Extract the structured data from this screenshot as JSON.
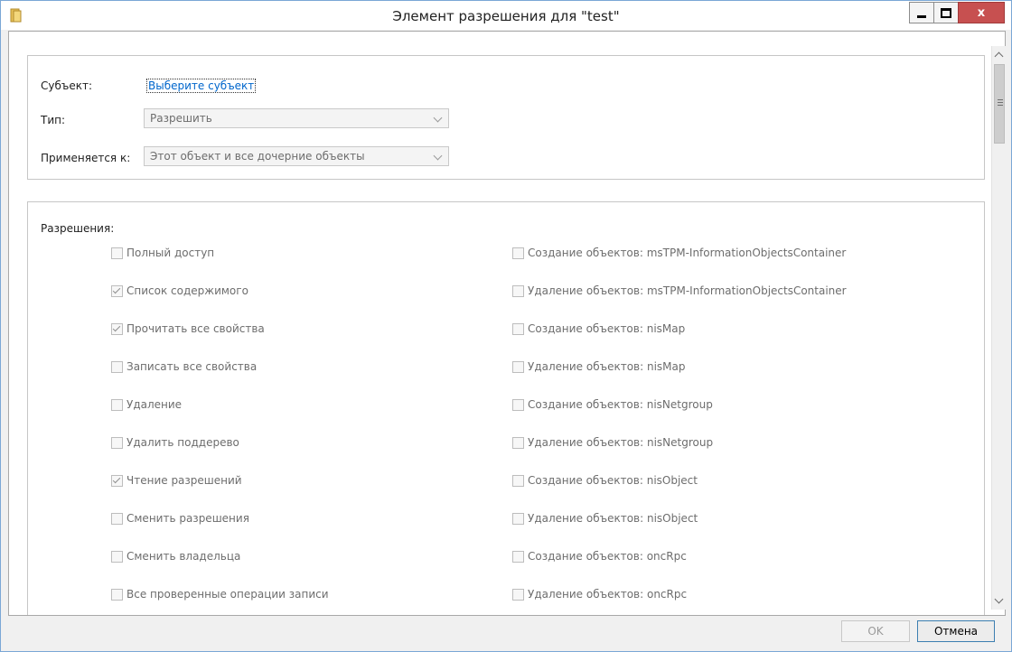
{
  "window": {
    "title": "Элемент разрешения для \"test\"",
    "close_label": "x"
  },
  "subject": {
    "label": "Субъект:",
    "link": "Выберите субъект"
  },
  "type": {
    "label": "Тип:",
    "value": "Разрешить"
  },
  "applies_to": {
    "label": "Применяется к:",
    "value": "Этот объект и все дочерние объекты"
  },
  "permissions": {
    "title": "Разрешения:",
    "left": [
      {
        "label": "Полный доступ",
        "checked": false
      },
      {
        "label": "Список содержимого",
        "checked": true
      },
      {
        "label": "Прочитать все свойства",
        "checked": true
      },
      {
        "label": "Записать все свойства",
        "checked": false
      },
      {
        "label": "Удаление",
        "checked": false
      },
      {
        "label": "Удалить поддерево",
        "checked": false
      },
      {
        "label": "Чтение разрешений",
        "checked": true
      },
      {
        "label": "Сменить разрешения",
        "checked": false
      },
      {
        "label": "Сменить владельца",
        "checked": false
      },
      {
        "label": "Все проверенные операции записи",
        "checked": false
      }
    ],
    "right": [
      {
        "label": "Создание объектов: msTPM-InformationObjectsContainer",
        "checked": false
      },
      {
        "label": "Удаление объектов: msTPM-InformationObjectsContainer",
        "checked": false
      },
      {
        "label": "Создание объектов: nisMap",
        "checked": false
      },
      {
        "label": "Удаление объектов: nisMap",
        "checked": false
      },
      {
        "label": "Создание объектов: nisNetgroup",
        "checked": false
      },
      {
        "label": "Удаление объектов: nisNetgroup",
        "checked": false
      },
      {
        "label": "Создание объектов: nisObject",
        "checked": false
      },
      {
        "label": "Удаление объектов: nisObject",
        "checked": false
      },
      {
        "label": "Создание объектов: oncRpc",
        "checked": false
      },
      {
        "label": "Удаление объектов: oncRpc",
        "checked": false
      }
    ]
  },
  "footer": {
    "ok_label": "OK",
    "cancel_label": "Отмена"
  }
}
